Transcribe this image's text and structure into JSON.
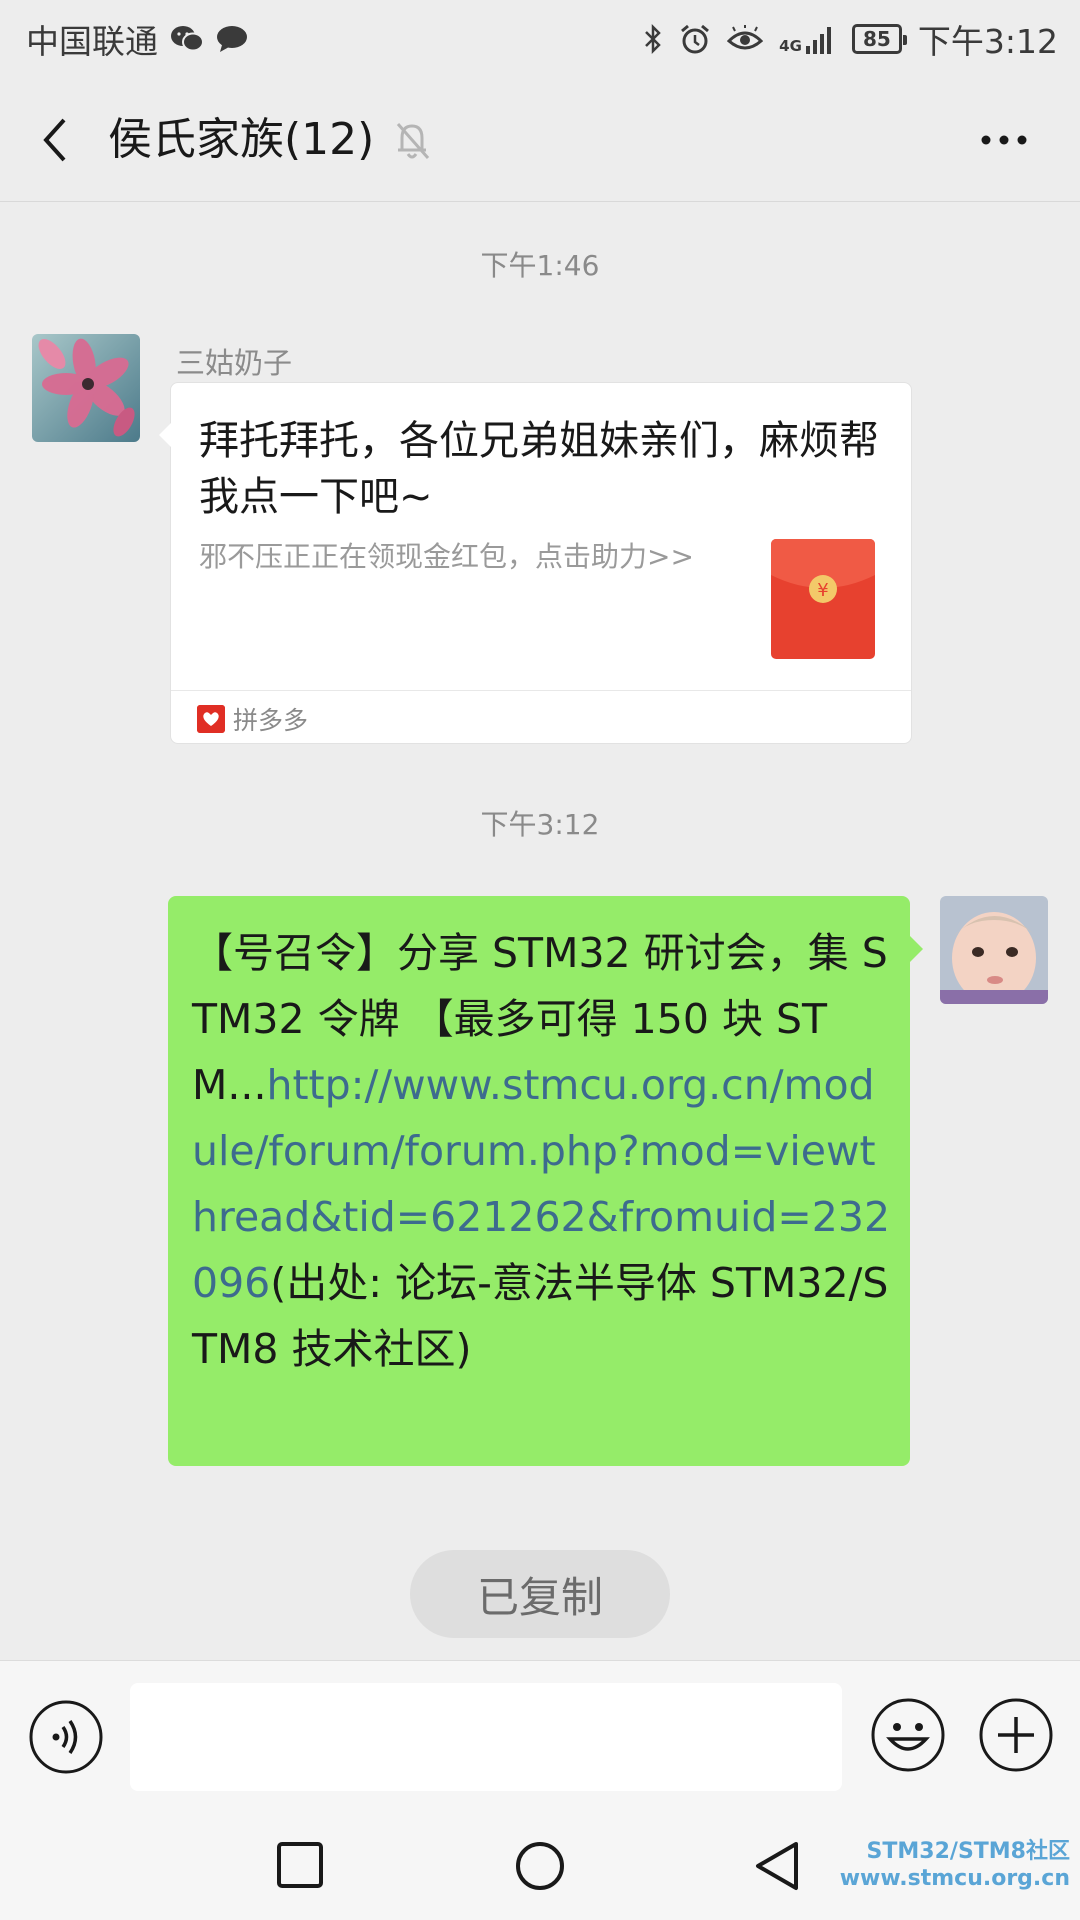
{
  "status_bar": {
    "carrier": "中国联通",
    "network": "4G",
    "battery": "85",
    "time": "下午3:12"
  },
  "header": {
    "title": "侯氏家族(12)"
  },
  "messages": {
    "ts1": "下午1:46",
    "card": {
      "sender": "三姑奶子",
      "title": "拜托拜托，各位兄弟姐妹亲们，麻烦帮我点一下吧~",
      "desc": "邪不压正正在领现金红包，点击助力>>",
      "source": "拼多多",
      "redpacket_symbol": "¥"
    },
    "ts2": "下午3:12",
    "bubble": {
      "text": "【号召令】分享 STM32 研讨会，集 STM32 令牌 【最多可得 150 块 STM...",
      "link": "http://www.stmcu.org.cn/module/forum/forum.php?mod=viewthread&tid=621262&fromuid=232096",
      "source": "(出处: 论坛-意法半导体 STM32/STM8 技术社区)"
    }
  },
  "toast": "已复制",
  "watermark": {
    "line1": "STM32/STM8社区",
    "line2": "www.stmcu.org.cn"
  },
  "colors": {
    "bubble_green": "#95ec69",
    "link_blue": "#3d6b8e",
    "redpacket": "#e7412f",
    "background": "#ededed"
  }
}
